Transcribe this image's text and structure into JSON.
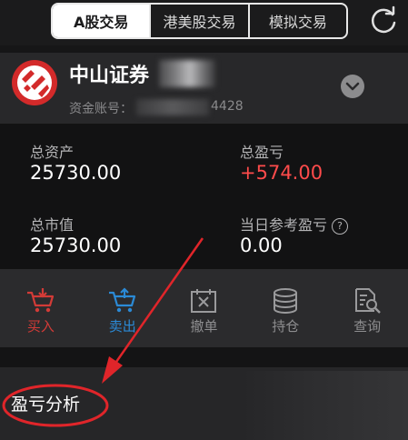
{
  "tabs": [
    {
      "label": "A股交易",
      "active": true
    },
    {
      "label": "港美股交易",
      "active": false
    },
    {
      "label": "模拟交易",
      "active": false
    }
  ],
  "account": {
    "name": "中山证券",
    "account_label": "资金账号：",
    "account_tail": "4428"
  },
  "stats": {
    "total_assets_label": "总资产",
    "total_assets_value": "25730.00",
    "total_pnl_label": "总盈亏",
    "total_pnl_value": "+574.00",
    "market_value_label": "总市值",
    "market_value_value": "25730.00",
    "daily_pnl_label": "当日参考盈亏",
    "daily_pnl_value": "0.00"
  },
  "actions": [
    {
      "label": "买入",
      "icon": "buy-cart-icon"
    },
    {
      "label": "卖出",
      "icon": "sell-cart-icon"
    },
    {
      "label": "撤单",
      "icon": "cancel-order-icon"
    },
    {
      "label": "持仓",
      "icon": "holdings-icon"
    },
    {
      "label": "查询",
      "icon": "query-icon"
    }
  ],
  "analysis": {
    "label": "盈亏分析"
  },
  "colors": {
    "profit_red": "#ff4b4b",
    "buy_red": "#d33b37",
    "sell_blue": "#2b8ad6",
    "annotation_red": "#e0252a"
  }
}
